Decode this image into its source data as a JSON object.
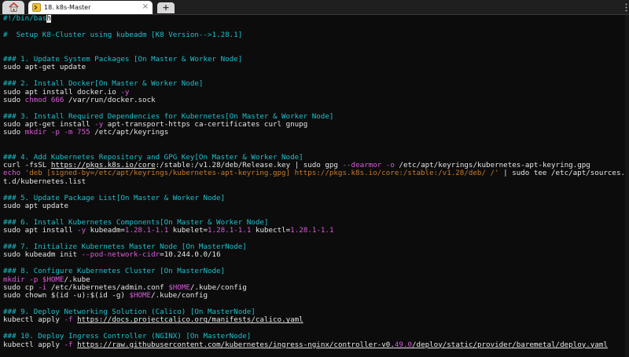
{
  "window": {
    "tab_title": "18. k8s-Master",
    "tab_close": "×",
    "new_tab": "+"
  },
  "icons": {
    "home": "home-icon",
    "tab": "terminal-session-icon",
    "close": "close-icon",
    "add": "plus-icon",
    "menu": "menu-dots-icon"
  },
  "colors": {
    "background": "#0c0c0c",
    "comment": "#1ec0cc",
    "flag": "#d85cd8",
    "string": "#c87a2a",
    "text": "#e6e6e6"
  },
  "terminal": {
    "shebang": "#!/bin/bas",
    "cursor_char": "h",
    "title_comment": "#  Setup K8-Cluster using kubeadm [K8 Version-->1.28.1]",
    "s1": {
      "heading": "### 1. Update System Packages [On Master & Worker Node]",
      "cmd": "sudo apt-get update"
    },
    "s2": {
      "heading": "### 2. Install Docker[On Master & Worker Node]",
      "l1_cmd": "sudo apt install docker.io ",
      "l1_flag": "-y",
      "l2_pre": "sudo ",
      "l2_chmod": "chmod 666",
      "l2_post": " /var/run/docker.sock"
    },
    "s3": {
      "heading": "### 3. Install Required Dependencies for Kubernetes[On Master & Worker Node]",
      "l1_pre": "sudo apt-get install ",
      "l1_flag": "-y",
      "l1_post": " apt-transport-https ca-certificates curl gnupg",
      "l2_pre": "sudo ",
      "l2_mk": "mkdir -p -m 755",
      "l2_post": " /etc/apt/keyrings"
    },
    "s4": {
      "heading": "### 4. Add Kubernetes Repository and GPG Key[On Master & Worker Node]",
      "l1_pre": "curl -fsSL ",
      "l1_url": "https://pkgs.k8s.io/core",
      "l1_mid": ":/stable:/v1.28/deb/Release.key | sudo gpg ",
      "l1_flags": "--dearmor -o",
      "l1_post": " /etc/apt/keyrings/kubernetes-apt-keyring.gpg",
      "l2_echo": "echo ",
      "l2_str": "'deb [signed-by=/etc/apt/keyrings/kubernetes-apt-keyring.gpg] https://pkgs.k8s.io/core:/stable:/v1.28/deb/ /'",
      "l2_post": " | sudo tee /etc/apt/sources.lis",
      "l3": "t.d/kubernetes.list"
    },
    "s5": {
      "heading": "### 5. Update Package List[On Master & Worker Node]",
      "cmd": "sudo apt update"
    },
    "s6": {
      "heading": "### 6. Install Kubernetes Components[On Master & Worker Node]",
      "pre": "sudo apt install ",
      "flag": "-y",
      "p1": " kubeadm=",
      "v1": "1.28.1-1.1",
      "p2": " kubelet=",
      "v2": "1.28.1-1.1",
      "p3": " kubectl=",
      "v3": "1.28.1-1.1"
    },
    "s7": {
      "heading": "### 7. Initialize Kubernetes Master Node [On MasterNode]",
      "pre": "sudo kubeadm init ",
      "flag": "--pod-network-cidr",
      "post": "=10.244.0.0/16"
    },
    "s8": {
      "heading": "### 8. Configure Kubernetes Cluster [On MasterNode]",
      "l1_mk": "mkdir -p $HOME",
      "l1_post": "/.kube",
      "l2_pre": "sudo cp ",
      "l2_flag": "-i",
      "l2_mid": " /etc/kubernetes/admin.conf ",
      "l2_var": "$HOME",
      "l2_post": "/.kube/config",
      "l3_pre": "sudo chown $(id -u):$(id -g) ",
      "l3_var": "$HOME",
      "l3_post": "/.kube/config"
    },
    "s9": {
      "heading": "### 9. Deploy Networking Solution (Calico) [On MasterNode]",
      "pre": "kubectl apply ",
      "flag": "-f",
      "sp": " ",
      "url": "https://docs.projectcalico.org/manifests/calico.yaml"
    },
    "s10": {
      "heading": "### 10. Deploy Ingress Controller (NGINX) [On MasterNode]",
      "pre": "kubectl apply ",
      "flag": "-f",
      "sp": " ",
      "url1": "https://raw.githubusercontent.com/kubernetes/ingress-nginx/controller-v0.",
      "url_num": "49.0",
      "url2": "/deploy/static/provider/baremetal/deploy.yaml"
    }
  }
}
